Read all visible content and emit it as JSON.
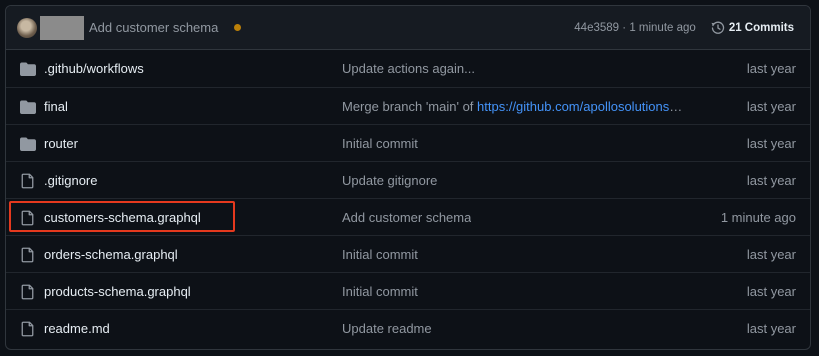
{
  "commit": {
    "message": "Add customer schema",
    "status_color": "#bb8009",
    "hash": "44e3589",
    "separator": "·",
    "time": "1 minute ago",
    "commits_label": "21 Commits",
    "history_icon": "history-icon"
  },
  "files": [
    {
      "type": "directory",
      "icon": "folder-icon",
      "name": ".github/workflows",
      "message": "Update actions again...",
      "message_link": "",
      "message_suffix": "",
      "time": "last year",
      "highlighted": false
    },
    {
      "type": "directory",
      "icon": "folder-icon",
      "name": "final",
      "message": "Merge branch 'main' of ",
      "message_link": "https://github.com/apollosolutions",
      "message_suffix": "…",
      "time": "last year",
      "highlighted": false
    },
    {
      "type": "directory",
      "icon": "folder-icon",
      "name": "router",
      "message": "Initial commit",
      "message_link": "",
      "message_suffix": "",
      "time": "last year",
      "highlighted": false
    },
    {
      "type": "file",
      "icon": "file-icon",
      "name": ".gitignore",
      "message": "Update gitignore",
      "message_link": "",
      "message_suffix": "",
      "time": "last year",
      "highlighted": false
    },
    {
      "type": "file",
      "icon": "file-icon",
      "name": "customers-schema.graphql",
      "message": "Add customer schema",
      "message_link": "",
      "message_suffix": "",
      "time": "1 minute ago",
      "highlighted": true
    },
    {
      "type": "file",
      "icon": "file-icon",
      "name": "orders-schema.graphql",
      "message": "Initial commit",
      "message_link": "",
      "message_suffix": "",
      "time": "last year",
      "highlighted": false
    },
    {
      "type": "file",
      "icon": "file-icon",
      "name": "products-schema.graphql",
      "message": "Initial commit",
      "message_link": "",
      "message_suffix": "",
      "time": "last year",
      "highlighted": false
    },
    {
      "type": "file",
      "icon": "file-icon",
      "name": "readme.md",
      "message": "Update readme",
      "message_link": "",
      "message_suffix": "",
      "time": "last year",
      "highlighted": false
    }
  ],
  "colors": {
    "highlight_border": "#e5391e",
    "link": "#4493f8"
  }
}
